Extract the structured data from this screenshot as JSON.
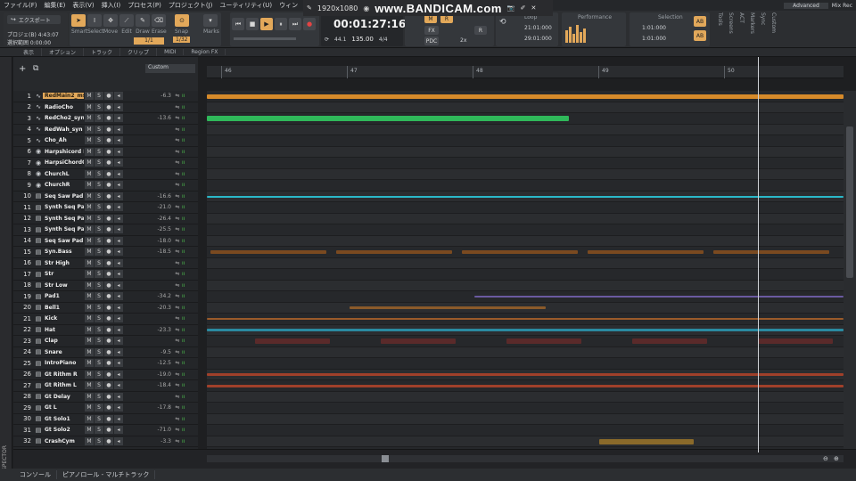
{
  "menu": [
    "ファイル(F)",
    "編集(E)",
    "表示(V)",
    "挿入(I)",
    "プロセス(P)",
    "プロジェクト(J)",
    "ユーティリティ(U)",
    "ウィン"
  ],
  "menu_right": {
    "workspace": "Advanced",
    "user": "Mix Rec"
  },
  "overlay": {
    "resolution": "1920x1080",
    "brand": "www.BANDICAM.com"
  },
  "control_bar": {
    "export_label": "エクスポート",
    "project_info": "プロジェ(B) 4:43:07",
    "selection_info": "選択範囲 0:00:00",
    "tools": [
      "Smart",
      "Select",
      "Move",
      "Edit",
      "Draw",
      "Erase"
    ],
    "snap_label": "Snap",
    "snap_value": "1/32",
    "marks_label": "Marks",
    "grid_value": "1/1",
    "time": "00:01:27:16",
    "sample_rate": "44.1",
    "bit": "16",
    "tempo": "135.00",
    "meter": "4/4",
    "fx_label": "FX",
    "pdc_label": "PDC",
    "speed": "2x",
    "loop_label": "Loop",
    "loop_start": "21:01:000",
    "loop_end": "29:01:000",
    "perf_label": "Performance",
    "selection_label": "Selection",
    "sel_start": "1:01:000",
    "sel_end": "1:01:000",
    "right_tabs": [
      "Tools",
      "Screens",
      "ACT",
      "Markers",
      "Sync",
      "Custom"
    ]
  },
  "toolbar2": [
    "表示",
    "オプション",
    "トラック",
    "クリップ",
    "MIDI",
    "Region FX"
  ],
  "track_header": {
    "preset": "Custom"
  },
  "ruler": [
    "46",
    "47",
    "48",
    "49",
    "50"
  ],
  "tracks": [
    {
      "n": "1",
      "name": "RedMain2_mst",
      "vol": "-6.3"
    },
    {
      "n": "2",
      "name": "RadioCho",
      "vol": ""
    },
    {
      "n": "3",
      "name": "RedCho2_synL",
      "vol": "-13.6"
    },
    {
      "n": "4",
      "name": "RedWah_syn (",
      "vol": ""
    },
    {
      "n": "5",
      "name": "Cho_Ah",
      "vol": ""
    },
    {
      "n": "6",
      "name": "Harpshicord R",
      "vol": ""
    },
    {
      "n": "7",
      "name": "HarpsiChordCe",
      "vol": ""
    },
    {
      "n": "8",
      "name": "ChurchL",
      "vol": ""
    },
    {
      "n": "9",
      "name": "ChurchR",
      "vol": ""
    },
    {
      "n": "10",
      "name": "Seq Saw Pad1",
      "vol": "-16.6"
    },
    {
      "n": "11",
      "name": "Synth Seq Pad:",
      "vol": "-21.0"
    },
    {
      "n": "12",
      "name": "Synth Seq Pad:",
      "vol": "-26.4"
    },
    {
      "n": "13",
      "name": "Synth Seq Pad:",
      "vol": "-25.5"
    },
    {
      "n": "14",
      "name": "Seq Saw Pad H",
      "vol": "-18.0"
    },
    {
      "n": "15",
      "name": "Syn.Bass",
      "vol": "-18.5"
    },
    {
      "n": "16",
      "name": "Str High",
      "vol": ""
    },
    {
      "n": "17",
      "name": "Str",
      "vol": ""
    },
    {
      "n": "18",
      "name": "Str Low",
      "vol": ""
    },
    {
      "n": "19",
      "name": "Pad1",
      "vol": "-34.2"
    },
    {
      "n": "20",
      "name": "Bell1",
      "vol": "-20.3"
    },
    {
      "n": "21",
      "name": "Kick",
      "vol": ""
    },
    {
      "n": "22",
      "name": "Hat",
      "vol": "-23.3"
    },
    {
      "n": "23",
      "name": "Clap",
      "vol": ""
    },
    {
      "n": "24",
      "name": "Snare",
      "vol": "-9.5"
    },
    {
      "n": "25",
      "name": "IntroPiano",
      "vol": "-12.5"
    },
    {
      "n": "26",
      "name": "Gt Rithm R",
      "vol": "-19.0"
    },
    {
      "n": "27",
      "name": "Gt Rithm L",
      "vol": "-18.4"
    },
    {
      "n": "28",
      "name": "Gt Delay",
      "vol": ""
    },
    {
      "n": "29",
      "name": "Gt  L",
      "vol": "-17.8"
    },
    {
      "n": "30",
      "name": "Gt Solo1",
      "vol": ""
    },
    {
      "n": "31",
      "name": "Gt Solo2",
      "vol": "-71.0"
    },
    {
      "n": "32",
      "name": "CrashCym",
      "vol": "-3.3"
    }
  ],
  "bottom_tabs": [
    "コンソール",
    "ピアノロール - マルチトラック"
  ],
  "inspector_label": "INSPECTOR",
  "colors": {
    "accent": "#e2a85a",
    "vocal": "#d68a2a",
    "green": "#2fb85a",
    "cyan": "#2ab8c8"
  }
}
